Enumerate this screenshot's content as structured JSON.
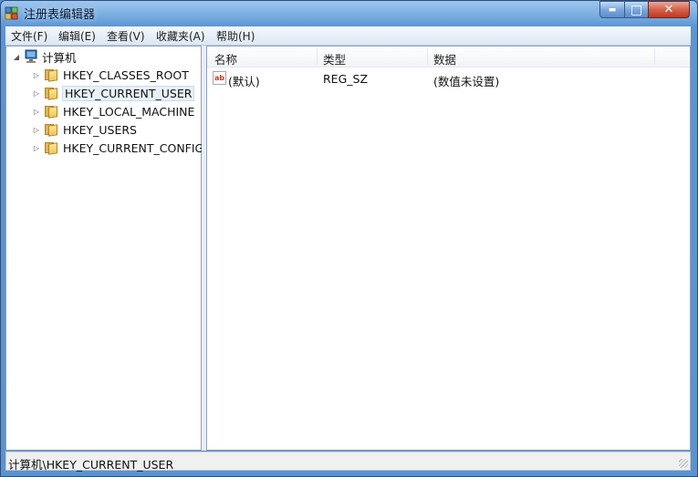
{
  "window": {
    "title": "注册表编辑器"
  },
  "controls": {
    "minimize": "▬",
    "maximize": "□",
    "close": "✕"
  },
  "menu": [
    "文件(F)",
    "编辑(E)",
    "查看(V)",
    "收藏夹(A)",
    "帮助(H)"
  ],
  "tree": {
    "root": "计算机",
    "root_expander": "◢",
    "child_expander": "▷",
    "children": [
      "HKEY_CLASSES_ROOT",
      "HKEY_CURRENT_USER",
      "HKEY_LOCAL_MACHINE",
      "HKEY_USERS",
      "HKEY_CURRENT_CONFIG"
    ],
    "selected": "HKEY_CURRENT_USER"
  },
  "list": {
    "columns": [
      "名称",
      "类型",
      "数据"
    ],
    "rows": [
      {
        "icon": "string-value-icon",
        "icon_text": "ab",
        "name": "(默认)",
        "type": "REG_SZ",
        "data": "(数值未设置)"
      }
    ]
  },
  "status": {
    "path": "计算机\\HKEY_CURRENT_USER"
  }
}
